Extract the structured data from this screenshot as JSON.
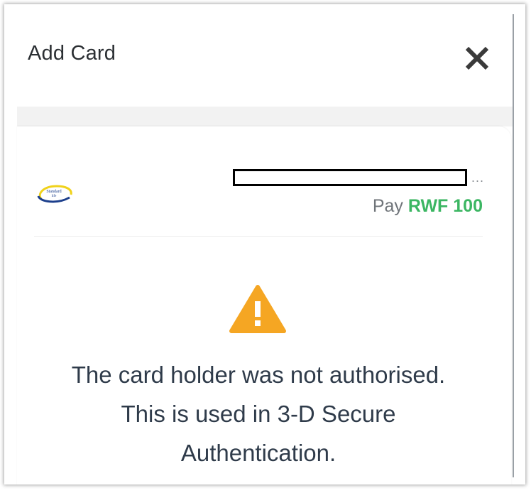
{
  "dialog": {
    "title": "Add Card",
    "close_icon": "close-icon"
  },
  "merchant": {
    "logo_icon": "standard-life-logo",
    "logo_text_line1": "Standard",
    "logo_text_line2": "life",
    "ellipsis": "...",
    "pay_label": "Pay",
    "pay_amount": "RWF 100"
  },
  "status": {
    "icon": "warning-icon",
    "message": "The card holder was not authorised. This is used in 3-D Secure Authentication."
  },
  "colors": {
    "amount": "#3bb662",
    "warning": "#f5a623",
    "text": "#2f3b4a"
  }
}
